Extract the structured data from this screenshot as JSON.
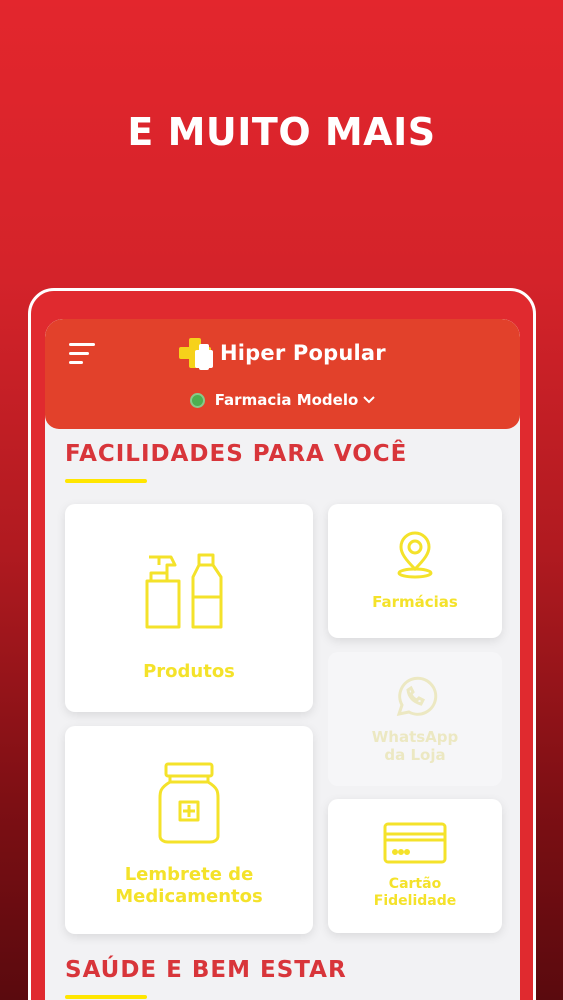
{
  "headline": "E MUITO MAIS",
  "app": {
    "brand_name": "Hiper Popular",
    "store": "Farmacia Modelo",
    "store_status_color": "#4caf50",
    "header_color": "#e2412b",
    "accent_yellow": "#f4e22a"
  },
  "sections": {
    "facilities": "FACILIDADES PARA VOCÊ",
    "health": "SAÚDE E BEM ESTAR"
  },
  "cards": {
    "produtos": {
      "label": "Produtos",
      "icon": "products-bottles-icon"
    },
    "farmacias": {
      "label": "Farmácias",
      "icon": "location-pin-icon"
    },
    "whatsapp": {
      "label": "WhatsApp\nda Loja",
      "icon": "whatsapp-icon"
    },
    "lembrete": {
      "label": "Lembrete de\nMedicamentos",
      "icon": "medicine-jar-icon"
    },
    "cartao": {
      "label": "Cartão\nFidelidade",
      "icon": "loyalty-card-icon"
    }
  }
}
